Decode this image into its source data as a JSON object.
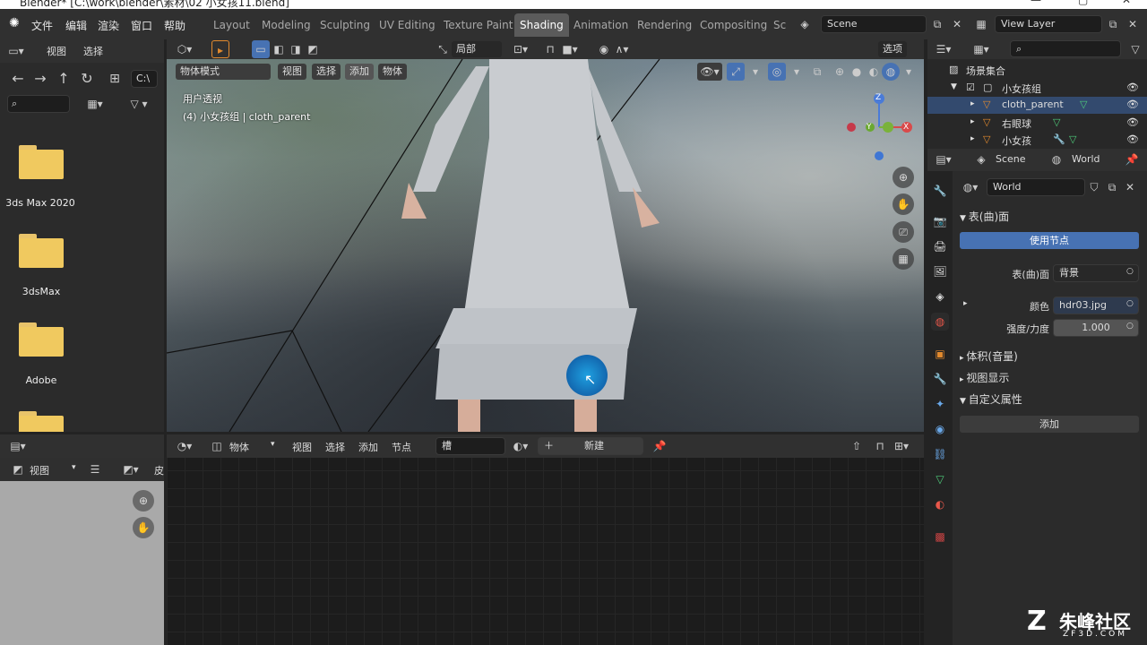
{
  "window": {
    "title": "Blender* [C:\\work\\blender\\素材\\02 小女孩11.blend]"
  },
  "menu": {
    "file": "文件",
    "edit": "编辑",
    "render": "渲染",
    "window": "窗口",
    "help": "帮助"
  },
  "workspaces": [
    "Layout",
    "Modeling",
    "Sculpting",
    "UV Editing",
    "Texture Paint",
    "Shading",
    "Animation",
    "Rendering",
    "Compositing",
    "Sc"
  ],
  "scene": {
    "name": "Scene",
    "view_layer": "View Layer"
  },
  "file_browser": {
    "header": {
      "view": "视图",
      "select": "选择"
    },
    "path": "C:\\",
    "folders": [
      "3ds Max 2020",
      "3dsMax",
      "Adobe",
      ""
    ]
  },
  "viewport": {
    "transform": "局部",
    "options": "选项",
    "mode": "物体模式",
    "menu": {
      "view": "视图",
      "select": "选择",
      "add": "添加",
      "object": "物体"
    },
    "overlay_title": "用户透视",
    "overlay_sub": "(4) 小女孩组 | cloth_parent",
    "gizmo": {
      "z": "Z",
      "y": "Y",
      "x": "X"
    }
  },
  "node_editor": {
    "type": "物体",
    "menu": {
      "view": "视图",
      "select": "选择",
      "add": "添加",
      "node": "节点"
    },
    "slot": "槽",
    "new": "新建"
  },
  "image_editor": {
    "view": "视图",
    "name": "皮"
  },
  "outliner": {
    "collection": "场景集合",
    "items": [
      {
        "name": "小女孩组",
        "type": "collection"
      },
      {
        "name": "cloth_parent",
        "type": "object"
      },
      {
        "name": "右眼球",
        "type": "object"
      },
      {
        "name": "小女孩",
        "type": "object"
      }
    ]
  },
  "properties": {
    "context_scene": "Scene",
    "context_world": "World",
    "world_name": "World",
    "surface_panel": "表(曲)面",
    "use_nodes": "使用节点",
    "surface_label": "表(曲)面",
    "surface_value": "背景",
    "color_label": "颜色",
    "color_value": "hdr03.jpg",
    "strength_label": "强度/力度",
    "strength_value": "1.000",
    "volume_panel": "体积(音量)",
    "viewport_display_panel": "视图显示",
    "custom_props_panel": "自定义属性",
    "add_button": "添加"
  },
  "watermark": {
    "text": "朱峰社区",
    "url": "ZF3D.COM"
  },
  "colors": {
    "accent": "#4772b3",
    "orange": "#e28a2e",
    "header": "#303030"
  }
}
